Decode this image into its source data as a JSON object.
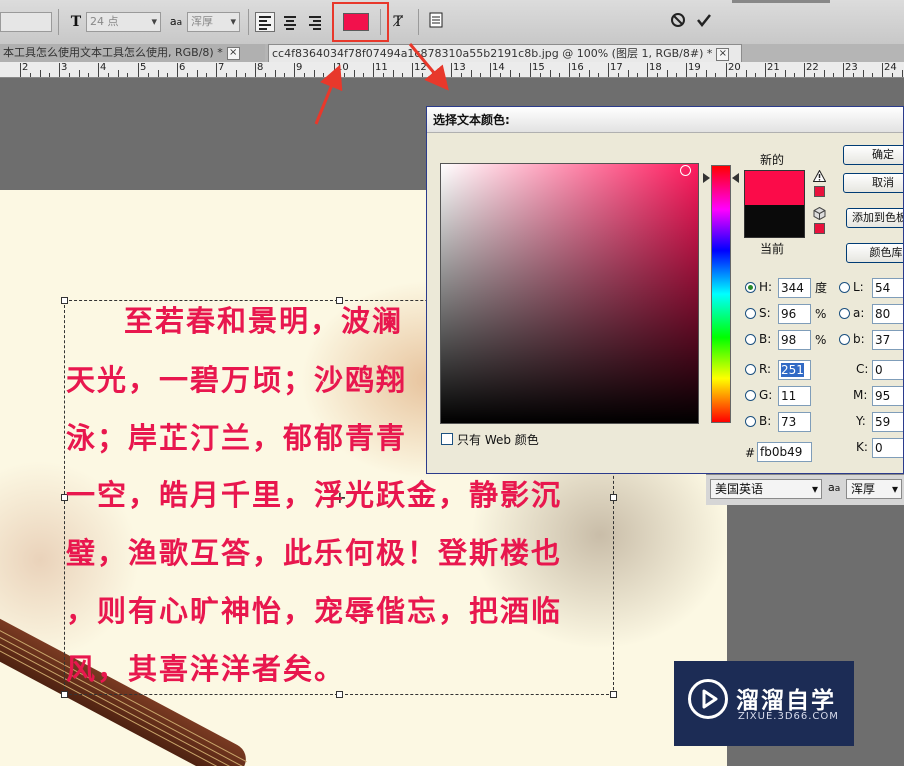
{
  "options_bar": {
    "font_size_value": "24 点",
    "aa_glyph": "a",
    "antialias_value": "浑厚",
    "text_color": "#f2114c"
  },
  "tabs": [
    {
      "label": "本工具怎么使用文本工具怎么使用, RGB/8) *",
      "close": "×"
    },
    {
      "label": "cc4f8364034f78f07494a1c878310a55b2191c8b.jpg @ 100% (图层 1, RGB/8#) *",
      "close": "×"
    }
  ],
  "ruler": {
    "labels": [
      "2",
      "3",
      "4",
      "5",
      "6",
      "7",
      "8",
      "9",
      "10",
      "11",
      "12",
      "13",
      "14",
      "15",
      "16",
      "17",
      "18",
      "19",
      "20",
      "21",
      "22",
      "23",
      "24"
    ]
  },
  "poem": {
    "lines": [
      "至若春和景明，波澜",
      "天光，一碧万顷；沙鸥翔",
      "泳；岸芷汀兰，郁郁青青",
      "一空，皓月千里，浮光跃金，静影沉",
      "璧，渔歌互答，此乐何极！登斯楼也",
      "，则有心旷神怡，宠辱偕忘，把酒临",
      "风，其喜洋洋者矣。"
    ]
  },
  "dialog": {
    "title": "选择文本颜色:",
    "new_label": "新的",
    "current_label": "当前",
    "new_color": "#fb0b49",
    "current_color": "#0a0a0a",
    "buttons": {
      "ok": "确定",
      "cancel": "取消",
      "add_swatch": "添加到色板",
      "libraries": "颜色库"
    },
    "web_only_label": "只有 Web 颜色",
    "hsb": [
      {
        "label": "H:",
        "value": "344",
        "unit": "度",
        "selected": true
      },
      {
        "label": "S:",
        "value": "96",
        "unit": "%",
        "selected": false
      },
      {
        "label": "B:",
        "value": "98",
        "unit": "%",
        "selected": false
      }
    ],
    "rgb": [
      {
        "label": "R:",
        "value": "251"
      },
      {
        "label": "G:",
        "value": "11"
      },
      {
        "label": "B:",
        "value": "73"
      }
    ],
    "lab": [
      {
        "label": "L:",
        "value": "54"
      },
      {
        "label": "a:",
        "value": "80"
      },
      {
        "label": "b:",
        "value": "37"
      }
    ],
    "cmyk": [
      {
        "label": "C:",
        "value": "0"
      },
      {
        "label": "M:",
        "value": "95"
      },
      {
        "label": "Y:",
        "value": "59"
      },
      {
        "label": "K:",
        "value": "0"
      }
    ],
    "hex_label": "#",
    "hex_value": "fb0b49"
  },
  "char_panel": {
    "language": "美国英语",
    "aa_glyph": "a",
    "antialias": "浑厚"
  },
  "watermark": {
    "title": "溜溜自学",
    "url": "ZIXUE.3D66.COM"
  }
}
